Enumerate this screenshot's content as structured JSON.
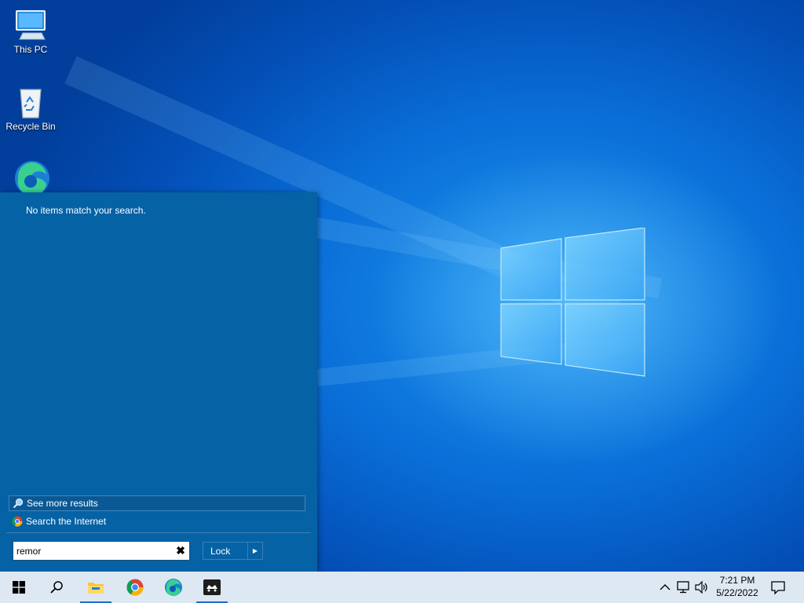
{
  "desktop": {
    "icons": [
      {
        "label": "This PC",
        "icon": "this-pc-icon"
      },
      {
        "label": "Recycle Bin",
        "icon": "recycle-bin-icon"
      },
      {
        "label": "",
        "icon": "edge-icon"
      },
      {
        "label": "",
        "icon": "blurred-app-icon"
      }
    ]
  },
  "start_panel": {
    "no_results": "No items match your search.",
    "see_more": "See more results",
    "search_internet": "Search the Internet",
    "search_value": "remor",
    "clear_glyph": "✖",
    "power_button": "Lock",
    "power_arrow": "▶"
  },
  "taskbar": {
    "items": [
      "start-button",
      "search-button",
      "file-explorer",
      "chrome",
      "edge",
      "app-with-dark-icon"
    ],
    "clock": {
      "time": "7:21 PM",
      "date": "5/22/2022"
    },
    "tray": [
      "chevron-up-icon",
      "network-icon",
      "volume-icon",
      "notification-icon"
    ]
  },
  "colors": {
    "panel_bg": "#0562a5",
    "taskbar_bg": "#dde8f3",
    "accent": "#1f6fc7"
  }
}
